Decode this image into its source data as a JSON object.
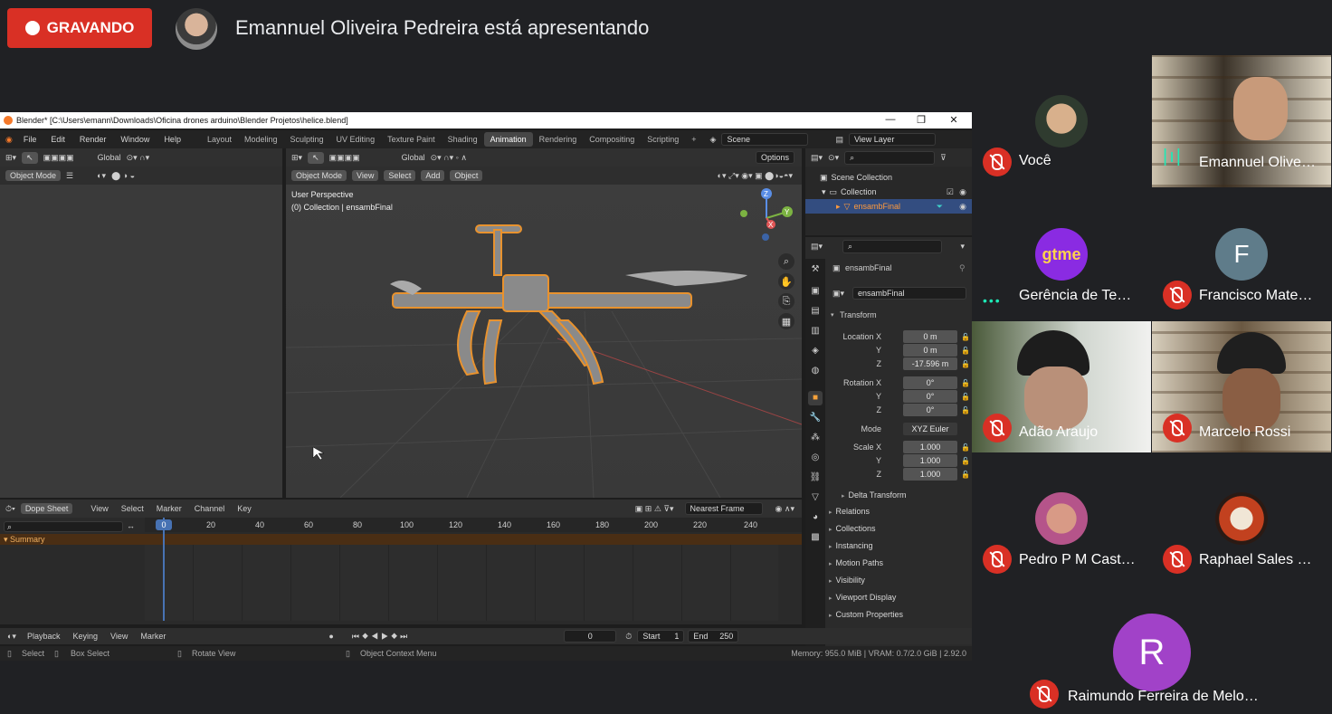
{
  "meet": {
    "recording_label": "GRAVANDO",
    "presenter_text": "Emannuel Oliveira Pedreira está apresentando",
    "participants": [
      {
        "name": "Você",
        "muted": true
      },
      {
        "name": "Emannuel Olive…",
        "muted": false
      },
      {
        "name": "Gerência de Te…",
        "muted": false
      },
      {
        "name": "Francisco Mate…",
        "muted": true,
        "initial": "F"
      },
      {
        "name": "Adão Araujo",
        "muted": true
      },
      {
        "name": "Marcelo Rossi",
        "muted": true
      },
      {
        "name": "Pedro P M Cast…",
        "muted": true
      },
      {
        "name": "Raphael Sales …",
        "muted": true
      },
      {
        "name": "Raimundo Ferreira de Melo…",
        "muted": true,
        "initial": "R"
      }
    ],
    "gtme_logo": "gtme",
    "colors": {
      "recording": "#d93025",
      "speaking": "#1de9b6",
      "avatar_f": "#5f7c8a",
      "avatar_r": "#a142c8"
    }
  },
  "blender": {
    "title": "Blender* [C:\\Users\\emann\\Downloads\\Oficina drones arduino\\Blender Projetos\\helice.blend]",
    "menus": [
      "File",
      "Edit",
      "Render",
      "Window",
      "Help"
    ],
    "workspaces": [
      "Layout",
      "Modeling",
      "Sculpting",
      "UV Editing",
      "Texture Paint",
      "Shading",
      "Animation",
      "Rendering",
      "Compositing",
      "Scripting"
    ],
    "active_workspace": "Animation",
    "scene": "Scene",
    "view_layer": "View Layer",
    "left_editor": {
      "mode": "Object Mode",
      "orientation": "Global"
    },
    "viewport": {
      "mode": "Object Mode",
      "menus": [
        "View",
        "Select",
        "Add",
        "Object"
      ],
      "orientation": "Global",
      "options": "Options",
      "perspective": "User Perspective",
      "collection_info": "(0) Collection | ensambFinal",
      "gizmo_axes": [
        "Z",
        "Y",
        "X"
      ]
    },
    "outliner": {
      "search_placeholder": "",
      "scene_collection": "Scene Collection",
      "collection": "Collection",
      "object": "ensambFinal"
    },
    "properties": {
      "object_name": "ensambFinal",
      "object_field": "ensambFinal",
      "transform_label": "Transform",
      "location_label": "Location X",
      "location": {
        "x": "0 m",
        "y": "0 m",
        "z": "-17.596 m"
      },
      "rotation_label": "Rotation X",
      "rotation": {
        "x": "0°",
        "y": "0°",
        "z": "0°"
      },
      "mode_label": "Mode",
      "mode_value": "XYZ Euler",
      "scale_label": "Scale X",
      "scale": {
        "x": "1.000",
        "y": "1.000",
        "z": "1.000"
      },
      "axis_y": "Y",
      "axis_z": "Z",
      "delta_transform": "Delta Transform",
      "sections": [
        "Relations",
        "Collections",
        "Instancing",
        "Motion Paths",
        "Visibility",
        "Viewport Display",
        "Custom Properties"
      ]
    },
    "dope_sheet": {
      "editor": "Dope Sheet",
      "menus": [
        "View",
        "Select",
        "Marker",
        "Channel",
        "Key"
      ],
      "snap": "Nearest Frame",
      "summary": "Summary",
      "current_frame_label": "0",
      "ticks": [
        "20",
        "40",
        "60",
        "80",
        "100",
        "120",
        "140",
        "160",
        "180",
        "200",
        "220",
        "240"
      ]
    },
    "timeline": {
      "menus": [
        "Playback",
        "Keying",
        "View",
        "Marker"
      ],
      "current_frame": "0",
      "start_label": "Start",
      "start": "1",
      "end_label": "End",
      "end": "250"
    },
    "status": {
      "select": "Select",
      "box_select": "Box Select",
      "rotate_view": "Rotate View",
      "context_menu": "Object Context Menu",
      "memory": "Memory: 955.0 MiB | VRAM: 0.7/2.0 GiB | 2.92.0"
    }
  }
}
